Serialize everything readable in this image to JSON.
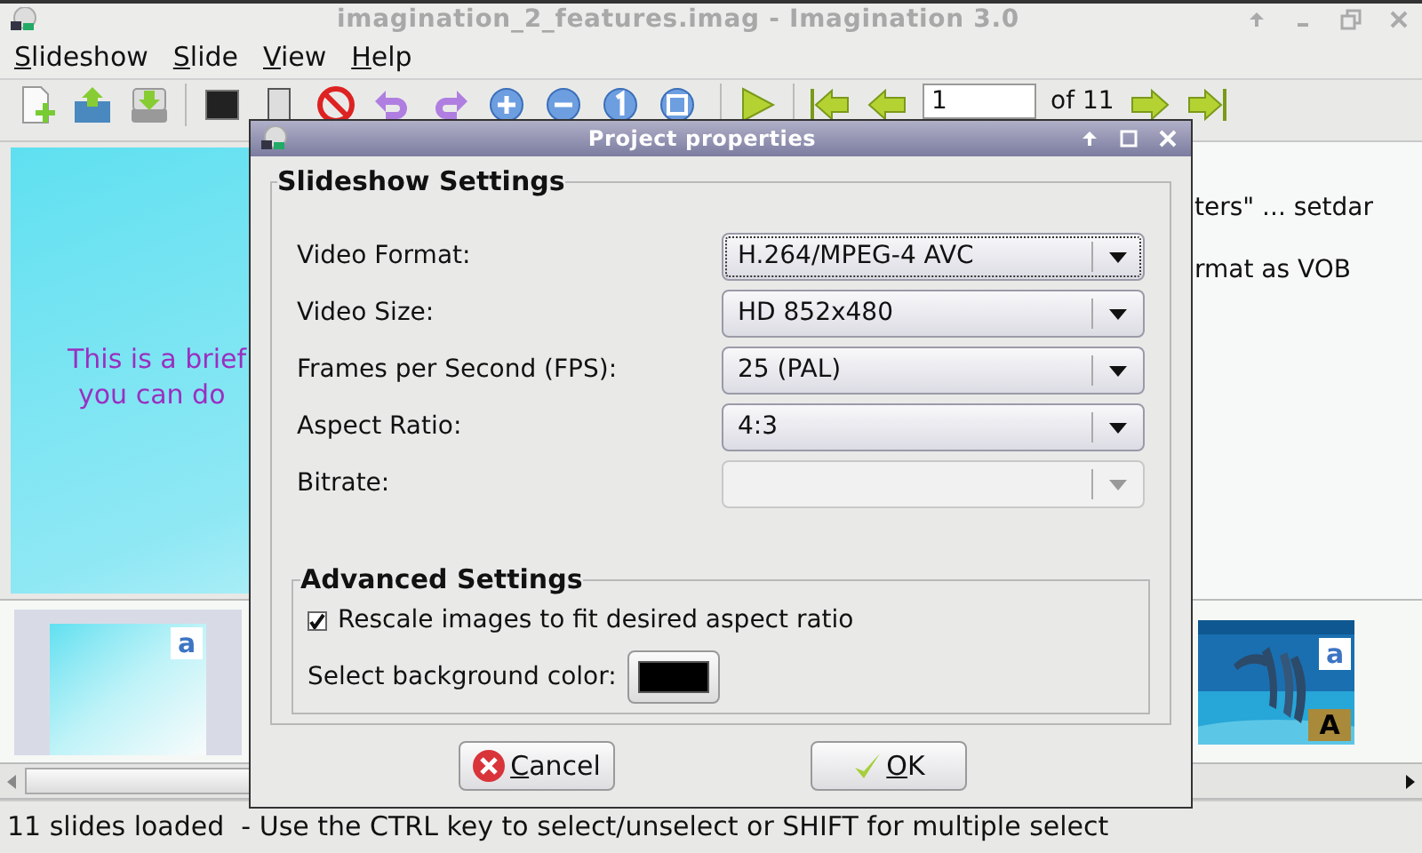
{
  "window": {
    "title": "imagination_2_features.imag - Imagination 3.0"
  },
  "menu": [
    {
      "label": "Slideshow"
    },
    {
      "label": "Slide"
    },
    {
      "label": "View"
    },
    {
      "label": "Help"
    }
  ],
  "toolbar": {
    "page": "1",
    "page_total": "of 11"
  },
  "slide_preview": {
    "lines": [
      "This is a brief",
      "you can do"
    ]
  },
  "notes": {
    "lines": [
      "ters\" ... setdar",
      "rmat as VOB"
    ]
  },
  "thumbnails": [
    {
      "kind": "gradient",
      "badges": [
        "a"
      ]
    },
    {
      "kind": "picture",
      "badges": [
        "a",
        "A"
      ]
    }
  ],
  "dialog": {
    "title": "Project properties",
    "group": {
      "title": "Slideshow Settings",
      "fields": [
        {
          "label": "Video Format:",
          "value": "H.264/MPEG-4 AVC",
          "disabled": false,
          "focused": true
        },
        {
          "label": "Video Size:",
          "value": "HD 852x480",
          "disabled": false,
          "focused": false
        },
        {
          "label": "Frames per Second (FPS):",
          "value": "25 (PAL)",
          "disabled": false,
          "focused": false
        },
        {
          "label": "Aspect Ratio:",
          "value": "4:3",
          "disabled": false,
          "focused": false
        },
        {
          "label": "Bitrate:",
          "disabled": true,
          "focused": false
        }
      ]
    },
    "advanced": {
      "title": "Advanced Settings",
      "checkbox": {
        "label": "Rescale images to fit desired aspect ratio",
        "checked": true
      },
      "color_label": "Select background color:",
      "color": "#000000"
    },
    "buttons": [
      {
        "kind": "cancel",
        "label": "Cancel"
      },
      {
        "kind": "ok",
        "label": "OK"
      }
    ]
  },
  "status_bar": "11 slides loaded  - Use the CTRL key to select/unselect or SHIFT for multiple select"
}
